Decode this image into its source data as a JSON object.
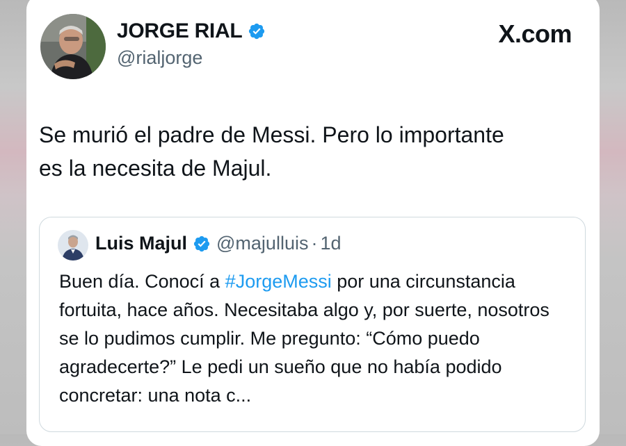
{
  "tweet": {
    "author_name": "JORGE RIAL",
    "author_handle": "@rialjorge",
    "site": "X.com",
    "text_line1": "Se murió el padre de Messi. Pero lo importante",
    "text_line2": "es la necesita de Majul."
  },
  "quote": {
    "author_name": "Luis Majul",
    "author_handle": "@majulluis",
    "separator": "·",
    "time": "1d",
    "text_before_hashtag": "Buen día. Conocí a ",
    "hashtag": "#JorgeMessi",
    "text_after_hashtag": " por una circunstancia fortuita, hace años. Necesitaba algo y, por suerte, nosotros se lo pudimos cumplir. Me pregunto: “Cómo puedo agradecerte?” Le pedi  un sueño que no había podido concretar: una nota c..."
  },
  "colors": {
    "verified": "#1d9bf0",
    "hashtag": "#1d9bf0",
    "secondary_text": "#536471",
    "primary_text": "#0f1419"
  },
  "icons": [
    "avatar-photo",
    "verified-badge-icon",
    "x-logo-icon"
  ]
}
